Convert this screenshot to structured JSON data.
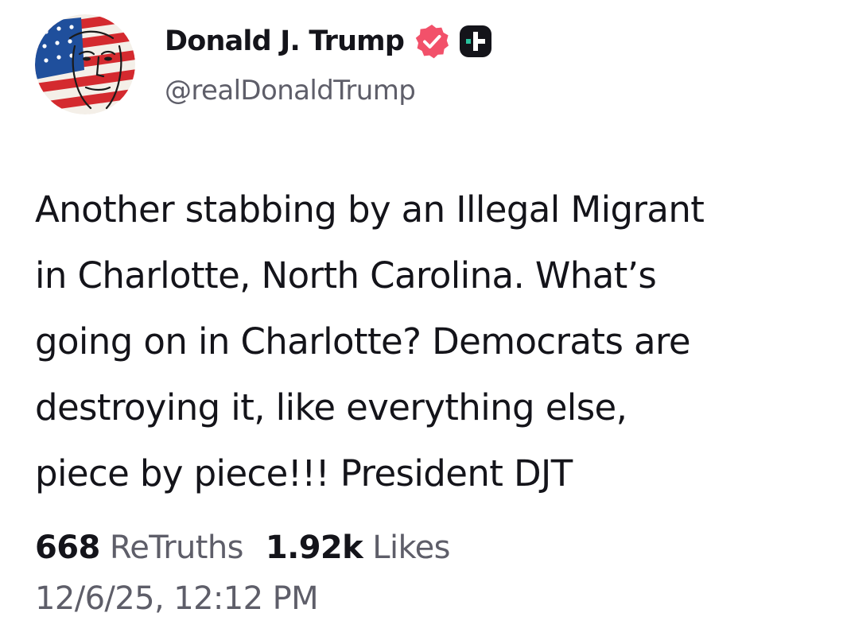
{
  "author": {
    "display_name": "Donald J. Trump",
    "handle": "@realDonaldTrump",
    "avatar_icon": "flag-portrait-avatar",
    "verified_icon": "verified-badge-icon",
    "plus_icon": "truth-plus-icon"
  },
  "post": {
    "lines": [
      "Another stabbing by an Illegal Migrant",
      "in Charlotte, North Carolina. What’s",
      "going on in Charlotte? Democrats are",
      "destroying it, like everything else,",
      "piece by piece!!! President DJT"
    ]
  },
  "stats": {
    "retruths_count": "668",
    "retruths_label": "ReTruths",
    "likes_count": "1.92k",
    "likes_label": "Likes"
  },
  "timestamp": "12/6/25, 12:12 PM",
  "colors": {
    "text": "#14141a",
    "muted": "#5e5e69",
    "verified": "#f2516a",
    "plus_badge": "#14141a",
    "plus_accent": "#29c39e"
  }
}
